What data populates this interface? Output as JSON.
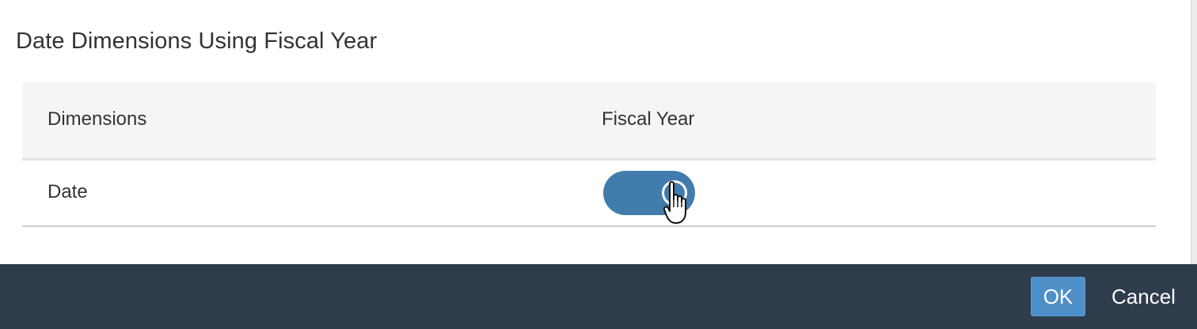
{
  "section": {
    "title": "Date Dimensions Using Fiscal Year"
  },
  "table": {
    "columns": [
      "Dimensions",
      "Fiscal Year"
    ],
    "rows": [
      {
        "dimension": "Date",
        "fiscal_year_enabled": true
      }
    ]
  },
  "footer": {
    "ok_label": "OK",
    "cancel_label": "Cancel"
  },
  "colors": {
    "switch_on": "#427cac",
    "footer_bg": "#2f3c4b",
    "ok_button_bg": "#4f8fc8"
  },
  "icons": {
    "cursor": "hand-pointer-icon",
    "switch_knob": "toggle-knob-icon"
  }
}
